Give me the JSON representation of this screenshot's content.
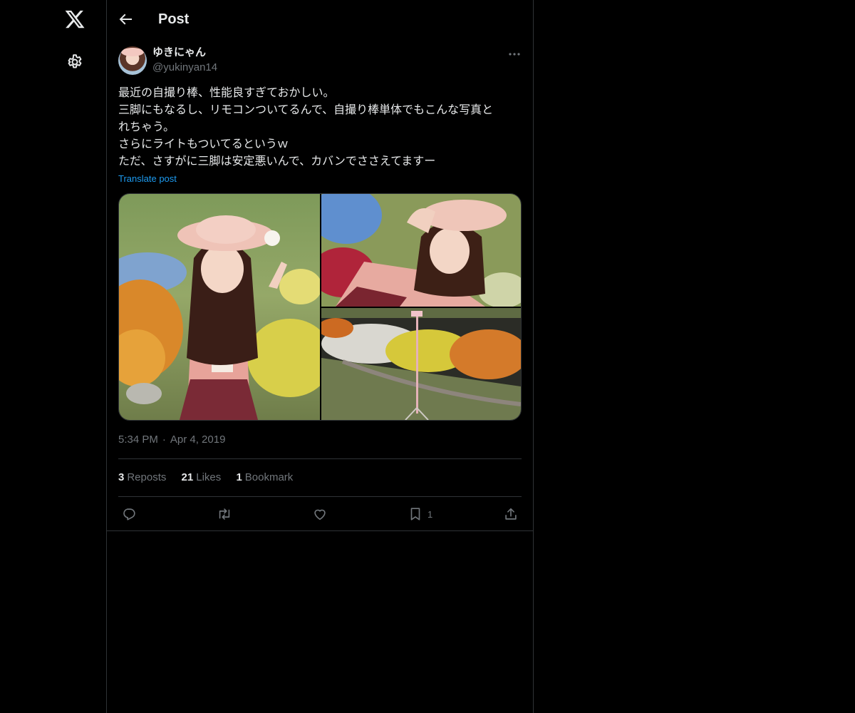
{
  "nav": {
    "logo_icon": "x-logo-icon",
    "settings_icon": "gear-icon"
  },
  "header": {
    "title": "Post",
    "back_icon": "arrow-left-icon"
  },
  "post": {
    "author": {
      "display_name": "ゆきにゃん",
      "handle": "@yukinyan14"
    },
    "more_icon": "more-horizontal-icon",
    "text_lines": [
      "最近の自撮り棒、性能良すぎておかしい。",
      "三脚にもなるし、リモコンついてるんで、自撮り棒単体でもこんな写真と",
      "れちゃう。",
      "さらにライトもついてるというｗ",
      "ただ、さすがに三脚は安定悪いんで、カバンでささえてますー"
    ],
    "translate_label": "Translate post",
    "time": "5:34 PM",
    "separator": "·",
    "date": "Apr 4, 2019",
    "stats": {
      "reposts_count": "3",
      "reposts_label": "Reposts",
      "likes_count": "21",
      "likes_label": "Likes",
      "bookmarks_count": "1",
      "bookmarks_label": "Bookmark"
    },
    "actions": {
      "reply_icon": "reply-icon",
      "repost_icon": "repost-icon",
      "like_icon": "heart-icon",
      "bookmark_icon": "bookmark-icon",
      "bookmark_count": "1",
      "share_icon": "share-icon"
    }
  },
  "colors": {
    "background": "#000000",
    "text_primary": "#e7e9ea",
    "text_secondary": "#71767b",
    "accent": "#1d9bf0",
    "border": "#2f3336"
  }
}
